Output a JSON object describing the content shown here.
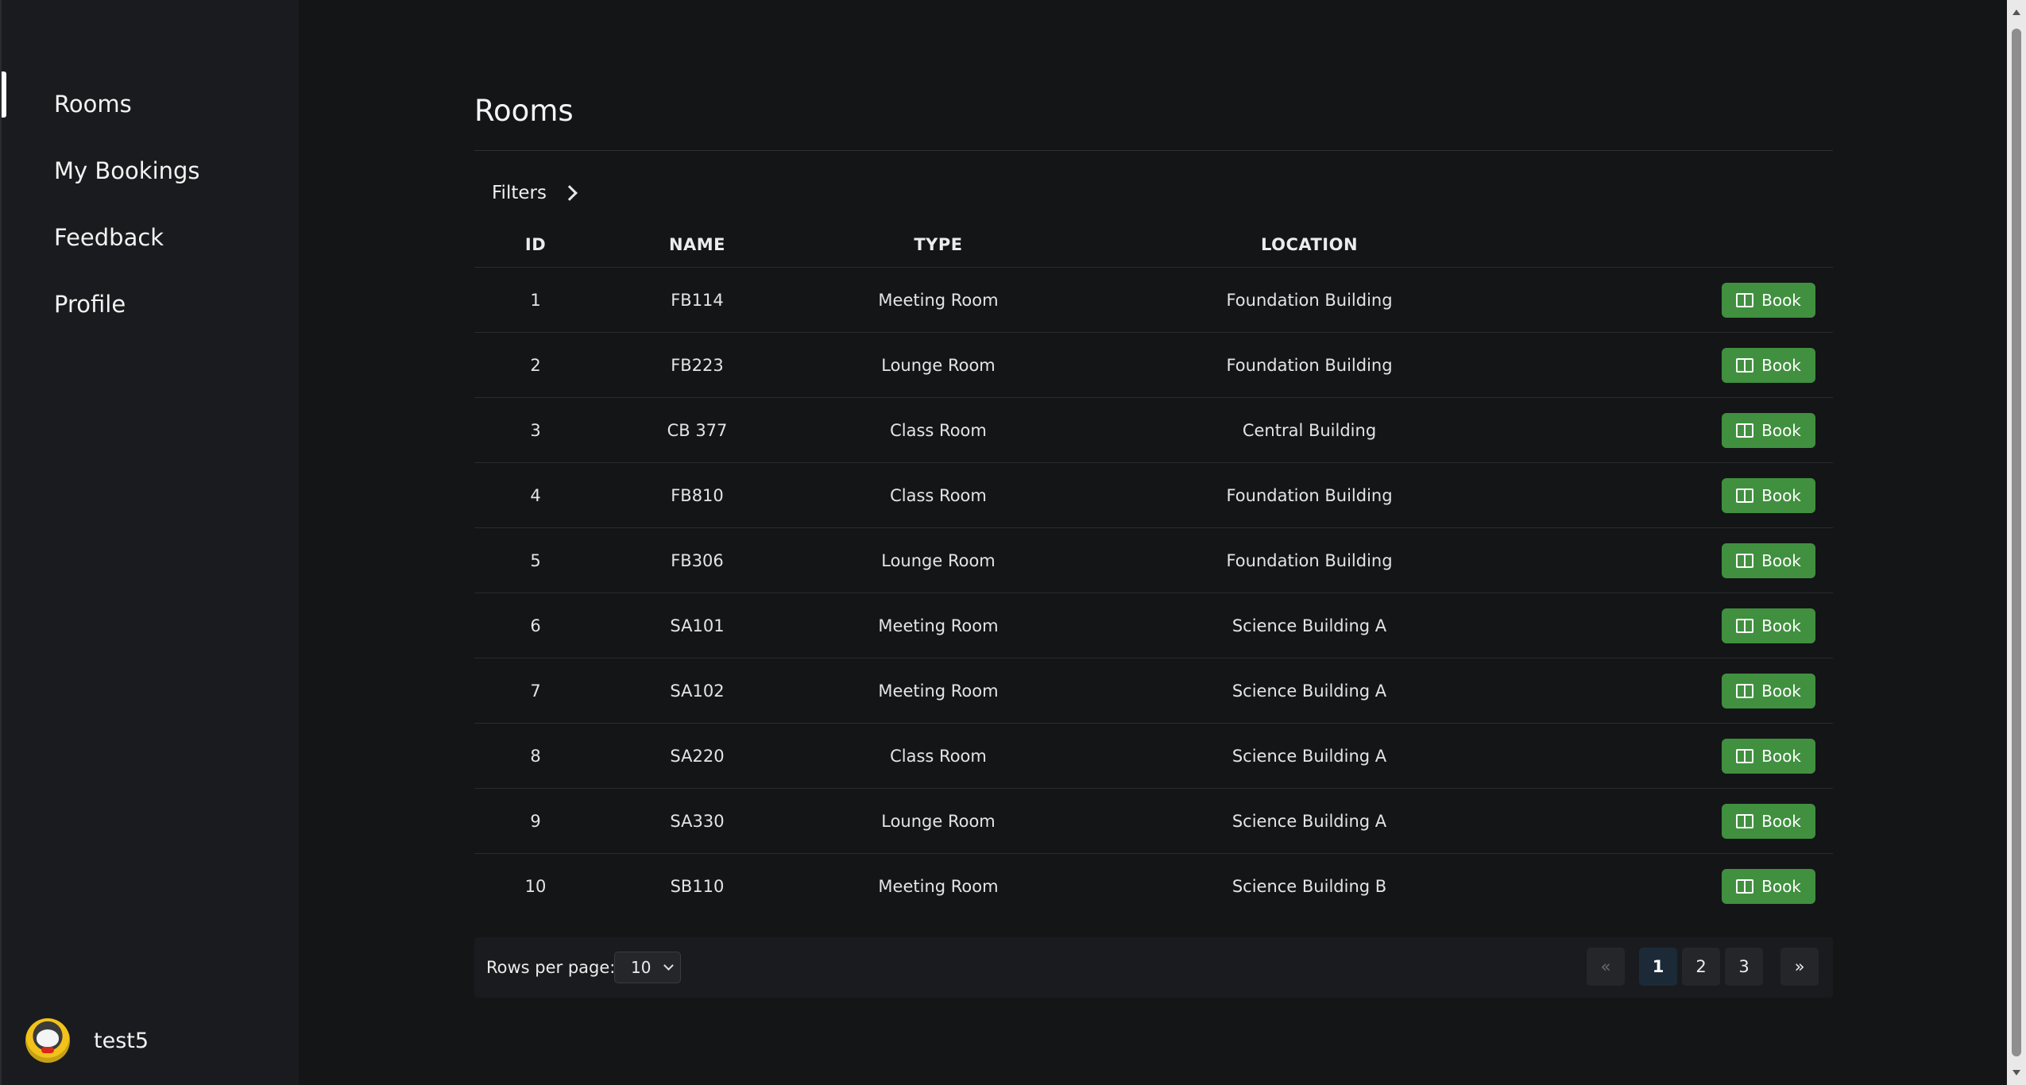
{
  "sidebar": {
    "items": [
      {
        "label": "Rooms",
        "active": true
      },
      {
        "label": "My Bookings"
      },
      {
        "label": "Feedback"
      },
      {
        "label": "Profile"
      }
    ],
    "user": {
      "name": "test5"
    }
  },
  "main": {
    "title": "Rooms",
    "filters_label": "Filters",
    "table": {
      "headers": {
        "id": "ID",
        "name": "NAME",
        "type": "TYPE",
        "location": "LOCATION"
      },
      "book_label": "Book",
      "rows": [
        {
          "id": "1",
          "name": "FB114",
          "type": "Meeting Room",
          "location": "Foundation Building"
        },
        {
          "id": "2",
          "name": "FB223",
          "type": "Lounge Room",
          "location": "Foundation Building"
        },
        {
          "id": "3",
          "name": "CB 377",
          "type": "Class Room",
          "location": "Central Building"
        },
        {
          "id": "4",
          "name": "FB810",
          "type": "Class Room",
          "location": "Foundation Building"
        },
        {
          "id": "5",
          "name": "FB306",
          "type": "Lounge Room",
          "location": "Foundation Building"
        },
        {
          "id": "6",
          "name": "SA101",
          "type": "Meeting Room",
          "location": "Science Building A"
        },
        {
          "id": "7",
          "name": "SA102",
          "type": "Meeting Room",
          "location": "Science Building A"
        },
        {
          "id": "8",
          "name": "SA220",
          "type": "Class Room",
          "location": "Science Building A"
        },
        {
          "id": "9",
          "name": "SA330",
          "type": "Lounge Room",
          "location": "Science Building A"
        },
        {
          "id": "10",
          "name": "SB110",
          "type": "Meeting Room",
          "location": "Science Building B"
        }
      ]
    },
    "pagination": {
      "rows_per_page_label": "Rows per page:",
      "rows_per_page_value": "10",
      "prev": "«",
      "next": "»",
      "pages": [
        "1",
        "2",
        "3"
      ],
      "current_page": "1"
    }
  },
  "colors": {
    "background": "#141517",
    "sidebar": "#1a1b1e",
    "book_button": "#40903f",
    "active_page": "#1c2a38"
  }
}
